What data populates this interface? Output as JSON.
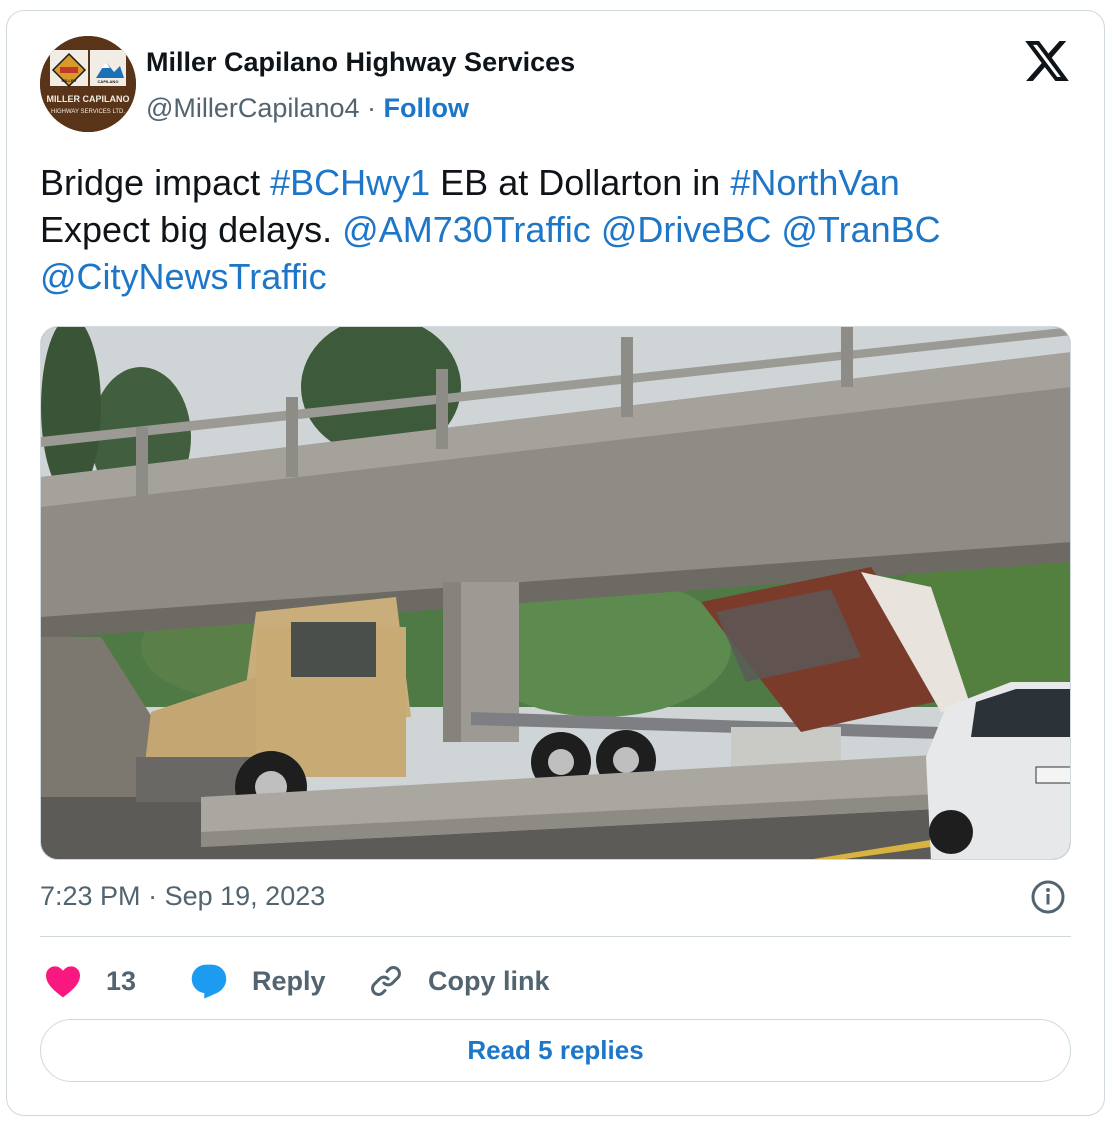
{
  "author": {
    "display_name": "Miller Capilano Highway Services",
    "handle": "@MillerCapilano4",
    "separator": "·",
    "follow_label": "Follow",
    "avatar_text_line1": "MILLER CAPILANO",
    "avatar_text_line2": "HIGHWAY SERVICES LTD.",
    "avatar_badge_left": "MILLER",
    "avatar_badge_right": "CAPILANO"
  },
  "tweet": {
    "segments": [
      {
        "text": "Bridge impact ",
        "link": false
      },
      {
        "text": "#BCHwy1",
        "link": true
      },
      {
        "text": " EB at Dollarton in ",
        "link": false
      },
      {
        "text": "#NorthVan",
        "link": true
      },
      {
        "text": " Expect big delays. ",
        "link": false
      },
      {
        "text": "@AM730Traffic",
        "link": true
      },
      {
        "text": " ",
        "link": false
      },
      {
        "text": "@DriveBC",
        "link": true
      },
      {
        "text": " ",
        "link": false
      },
      {
        "text": "@TranBC",
        "link": true
      },
      {
        "text": " ",
        "link": false
      },
      {
        "text": "@CityNewsTraffic",
        "link": true
      }
    ]
  },
  "meta": {
    "time": "7:23 PM",
    "separator": "·",
    "date": "Sep 19, 2023"
  },
  "actions": {
    "like_count": "13",
    "reply_label": "Reply",
    "copy_link_label": "Copy link"
  },
  "read_replies_label": "Read 5 replies",
  "colors": {
    "link": "#1d76c8",
    "heart": "#f91880",
    "reply_bubble": "#1d9bf0",
    "muted_text": "#536471",
    "border": "#cfd9de"
  },
  "icons": [
    "x-logo-icon",
    "info-icon",
    "heart-icon",
    "reply-bubble-icon",
    "link-icon"
  ]
}
